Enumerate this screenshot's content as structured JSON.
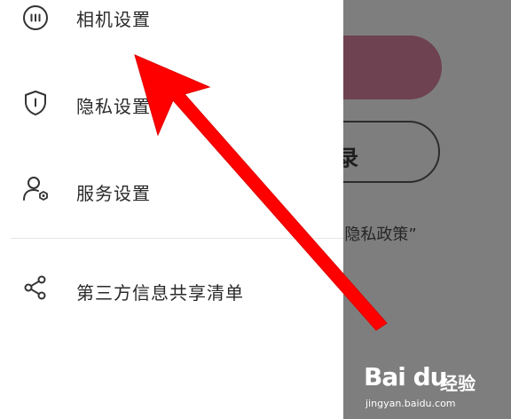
{
  "drawer": {
    "items": [
      {
        "label": "相机设置",
        "icon": "camera-settings-icon"
      },
      {
        "label": "隐私设置",
        "icon": "shield-icon"
      },
      {
        "label": "服务设置",
        "icon": "user-service-icon"
      },
      {
        "label": "第三方信息共享清单",
        "icon": "share-icon"
      }
    ]
  },
  "background": {
    "login_button_partial": "录",
    "policy_text_partial": "“隐私政策”"
  },
  "watermark": {
    "logo": "Bai du",
    "experience": "经验",
    "url": "jingyan.baidu.com"
  },
  "colors": {
    "overlay": "#7e7e7e",
    "filled_button": "#6e4251",
    "arrow": "#ff0000",
    "drawer_bg": "#ffffff"
  }
}
